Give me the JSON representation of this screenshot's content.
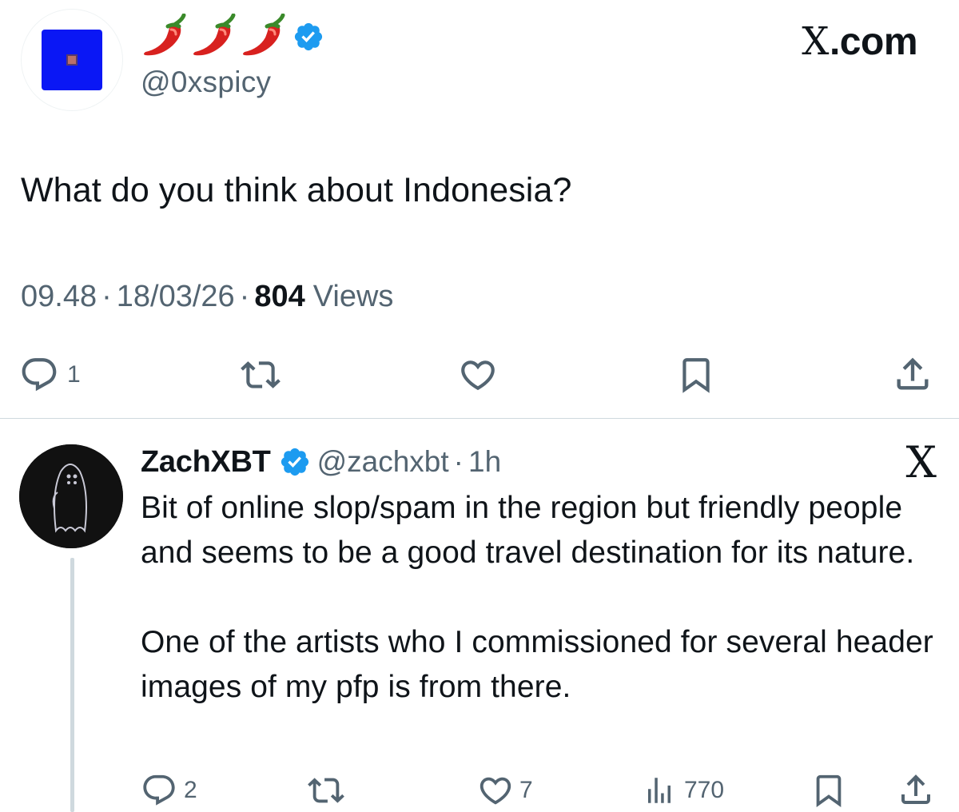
{
  "main_tweet": {
    "display_name": "🌶️🌶️🌶️",
    "handle": "@0xspicy",
    "text": "What do you think about Indonesia?",
    "time": "09.48",
    "date": "18/03/26",
    "views_count": "804",
    "views_label": "Views",
    "separator": "·",
    "reply_count": "1"
  },
  "brand": {
    "label": ".com",
    "mark": "X"
  },
  "reply": {
    "name": "ZachXBT",
    "handle": "@zachxbt",
    "separator": "·",
    "time": "1h",
    "x_mark": "X",
    "text_p1": "Bit of online slop/spam in the region but friendly people and seems to be a good travel destination for its nature.",
    "text_p2": "One of the artists who I commissioned for several header images of my pfp is from there.",
    "reply_count": "2",
    "like_count": "7",
    "view_count": "770"
  },
  "colors": {
    "verified": "#1d9bf0",
    "secondary_text": "#536471",
    "primary_text": "#0f1419",
    "avatar_blue": "#0a17f5"
  },
  "icons": [
    "chili-pepper-icon",
    "verified-badge-icon",
    "reply-icon",
    "retweet-icon",
    "like-icon",
    "bookmark-icon",
    "share-icon",
    "views-icon"
  ]
}
